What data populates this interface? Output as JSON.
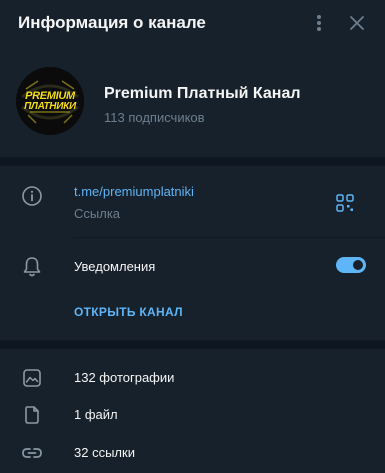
{
  "header": {
    "title": "Информация о канале",
    "menu_icon": "more-vertical-icon",
    "close_icon": "close-icon"
  },
  "profile": {
    "avatar_text_top": "PREMIUM",
    "avatar_text_bottom": "ПЛАТНИКИ",
    "name": "Premium Платный Канал",
    "subscribers": "113 подписчиков"
  },
  "info": {
    "link": "t.me/premiumplatniki",
    "link_caption": "Ссылка",
    "info_icon": "info-icon",
    "qr_icon": "qr-code-icon"
  },
  "notifications": {
    "label": "Уведомления",
    "enabled": true,
    "icon": "bell-icon"
  },
  "actions": {
    "open_channel": "ОТКРЫТЬ КАНАЛ"
  },
  "media": [
    {
      "label": "132 фотографии",
      "icon": "photo-icon"
    },
    {
      "label": "1 файл",
      "icon": "file-icon"
    },
    {
      "label": "32 ссылки",
      "icon": "link-icon"
    }
  ],
  "colors": {
    "background": "#17212b",
    "divider": "#0e1621",
    "accent": "#5eb5f7",
    "secondary_text": "#6d7f8f",
    "logo_yellow": "#f3dd1c"
  }
}
